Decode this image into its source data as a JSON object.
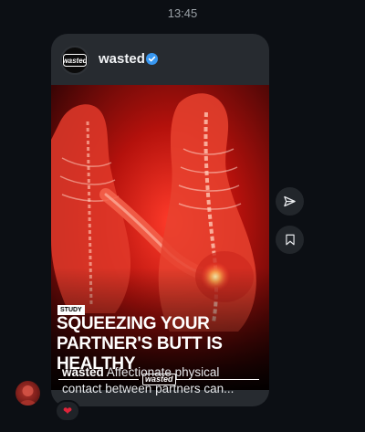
{
  "thread": {
    "timestamp": "13:45"
  },
  "post": {
    "account_name": "wasted",
    "verified": true,
    "logo_text": "wasted",
    "image": {
      "tag": "STUDY",
      "headline_line1": "SQUEEZING YOUR",
      "headline_line2": "PARTNER'S BUTT IS",
      "headline_line3": "HEALTHY",
      "watermark": "wasted"
    },
    "caption_account": "wasted",
    "caption_text": "Affectionate physical contact between partners can..."
  },
  "actions": {
    "share_icon": "send-icon",
    "save_icon": "bookmark-icon"
  },
  "reaction": {
    "emoji": "❤"
  },
  "colors": {
    "background": "#0c0f14",
    "bubble": "#272b30",
    "verified": "#3897f0",
    "image_red": "#c0140f",
    "reaction_heart": "#e0243a"
  }
}
